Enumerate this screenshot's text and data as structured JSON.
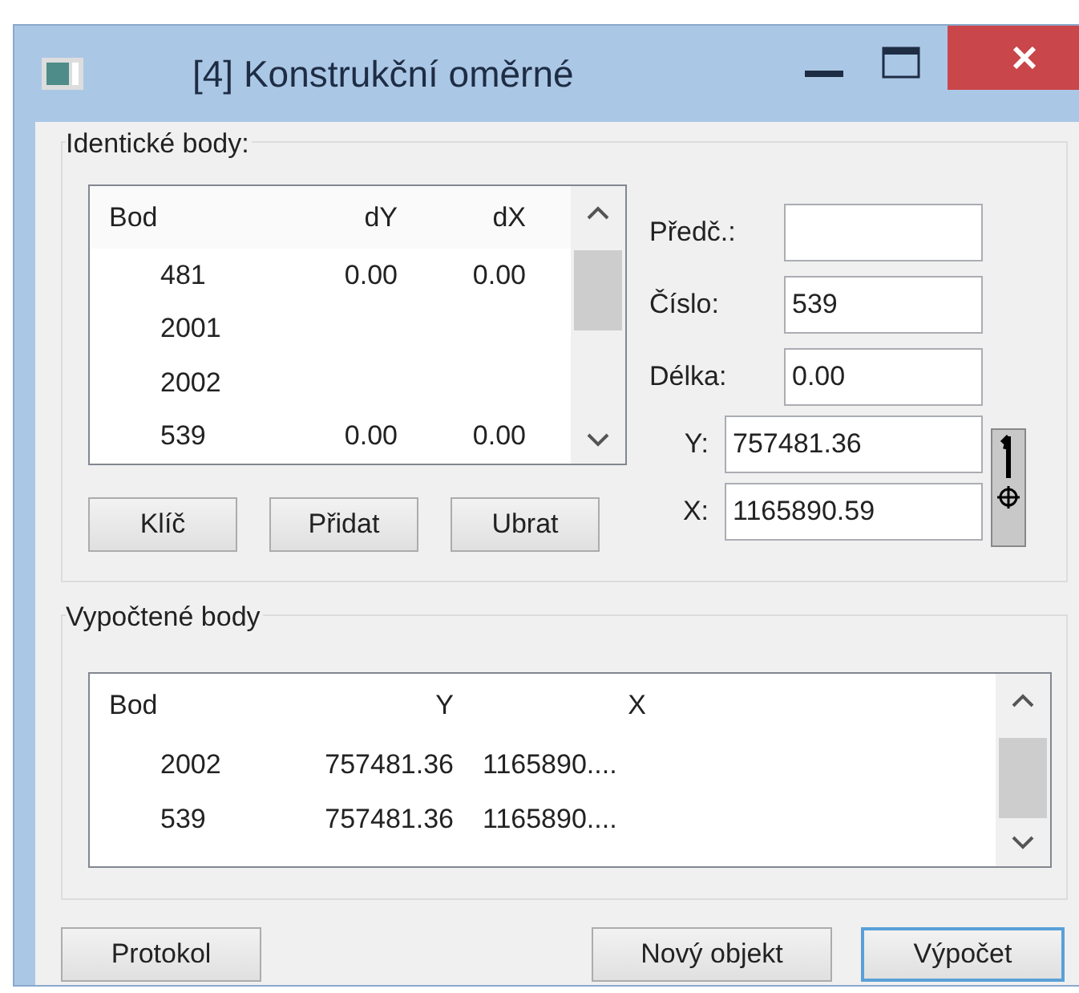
{
  "window": {
    "title": "[4] Konstrukční oměrné"
  },
  "identical_points": {
    "title": "Identické body:",
    "columns": [
      "Bod",
      "dY",
      "dX"
    ],
    "rows": [
      [
        "481",
        "0.00",
        "0.00"
      ],
      [
        "2001",
        "",
        ""
      ],
      [
        "2002",
        "",
        ""
      ],
      [
        "539",
        "0.00",
        "0.00"
      ]
    ],
    "buttons": [
      "Klíč",
      "Přidat",
      "Ubrat"
    ]
  },
  "fields": [
    {
      "label": "Předč.:",
      "kind": "wide"
    },
    {
      "label": "Číslo:",
      "value": "539",
      "kind": "wide"
    },
    {
      "label": "Délka:",
      "value": "0.00",
      "kind": "wide"
    },
    {
      "label": "Y:",
      "value": "757481.36",
      "kind": "coord"
    },
    {
      "label": "X:",
      "value": "1165890.59",
      "kind": "coord"
    }
  ],
  "computed_points": {
    "title": "Vypočtené body",
    "columns": [
      "Bod",
      "Y",
      "X"
    ],
    "rows": [
      [
        "2002",
        "757481.36",
        "1165890...."
      ],
      [
        "539",
        "757481.36",
        "1165890...."
      ]
    ]
  },
  "buttons": [
    {
      "label": "Protokol",
      "default": false
    },
    {
      "label": "Nový objekt",
      "default": false
    },
    {
      "label": "Výpočet",
      "default": true
    }
  ]
}
